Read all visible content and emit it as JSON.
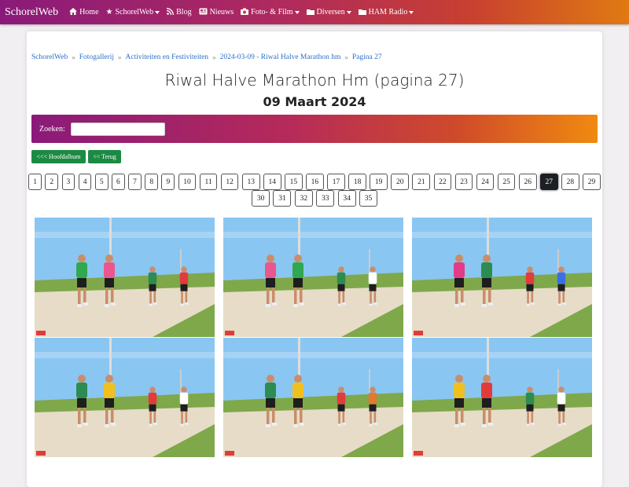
{
  "navbar": {
    "brand": "SchorelWeb",
    "items": [
      {
        "label": "Home",
        "icon": "home-icon",
        "dropdown": false
      },
      {
        "label": "SchorelWeb",
        "icon": "star-icon",
        "dropdown": true
      },
      {
        "label": "Blog",
        "icon": "rss-icon",
        "dropdown": false
      },
      {
        "label": "Nieuws",
        "icon": "newspaper-icon",
        "dropdown": false
      },
      {
        "label": "Foto- & Film",
        "icon": "camera-icon",
        "dropdown": true
      },
      {
        "label": "Diversen",
        "icon": "folder-icon",
        "dropdown": true
      },
      {
        "label": "HAM Radio",
        "icon": "folder-icon",
        "dropdown": true
      }
    ]
  },
  "breadcrumb": [
    "SchorelWeb",
    "Fotogallerij",
    "Activiteiten en Festiviteiten",
    "2024-03-09 - Riwal Halve Marathon hm",
    "Pagina 27"
  ],
  "page": {
    "title": "Riwal Halve Marathon Hm (pagina 27)",
    "subtitle": "09 Maart 2024"
  },
  "search": {
    "label": "Zoeken:",
    "value": "",
    "placeholder": ""
  },
  "buttons": {
    "main_album": "<<< Hoofdalbum",
    "back": "<< Terug"
  },
  "pagination": {
    "row1": [
      "1",
      "2",
      "3",
      "4",
      "5",
      "6",
      "7",
      "8",
      "9",
      "10",
      "11",
      "12",
      "13",
      "14",
      "15",
      "16",
      "17",
      "18",
      "19",
      "20",
      "21",
      "22",
      "23",
      "24",
      "25",
      "26",
      "27",
      "28",
      "29"
    ],
    "row2": [
      "30",
      "31",
      "32",
      "33",
      "34",
      "35"
    ],
    "current": "27"
  },
  "photos": [
    {
      "alt": "runners-photo"
    },
    {
      "alt": "runners-photo"
    },
    {
      "alt": "runners-photo"
    },
    {
      "alt": "runners-photo"
    },
    {
      "alt": "runners-photo"
    },
    {
      "alt": "runners-photo"
    }
  ],
  "colors": {
    "accent_start": "#8a1a7a",
    "accent_end": "#f08a10",
    "button_green": "#1c8a43",
    "link": "#2a6fc9"
  }
}
